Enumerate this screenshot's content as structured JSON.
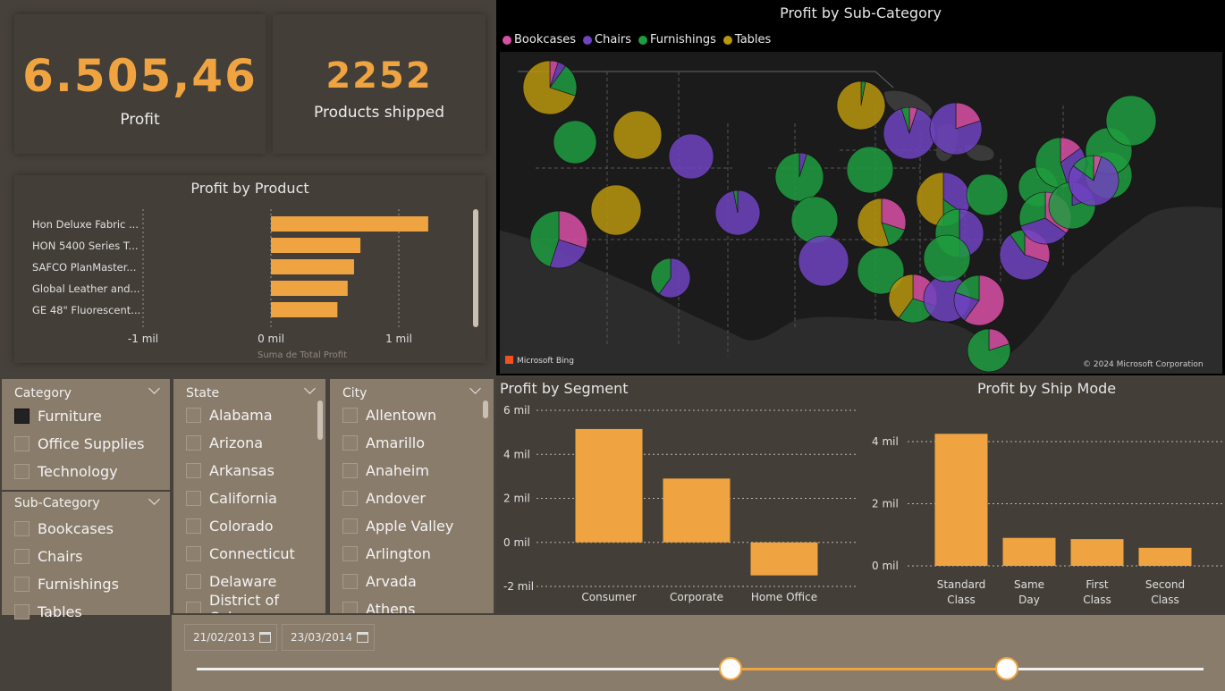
{
  "kpi": {
    "profit_value": "6.505,46",
    "profit_label": "Profit",
    "shipped_value": "2252",
    "shipped_label": "Products shipped"
  },
  "profit_by_product": {
    "title": "Profit by Product",
    "xlabel": "Suma de Total Profit",
    "ticks": [
      "-1 mil",
      "0 mil",
      "1 mil"
    ],
    "chart_data": {
      "type": "bar",
      "orientation": "horizontal",
      "title": "Profit by Product",
      "xlabel": "Suma de Total Profit",
      "categories": [
        "Hon Deluxe Fabric ...",
        "HON 5400 Series T...",
        "SAFCO PlanMaster...",
        "Global Leather and...",
        "GE 48\" Fluorescent..."
      ],
      "values": [
        1.23,
        0.7,
        0.65,
        0.6,
        0.52
      ],
      "unit": "mil",
      "xlim": [
        -1,
        1
      ],
      "color": "#efa441"
    }
  },
  "map": {
    "title": "Profit by Sub-Category",
    "legend": [
      {
        "name": "Bookcases",
        "color": "#d94fa5"
      },
      {
        "name": "Chairs",
        "color": "#6e43bf"
      },
      {
        "name": "Furnishings",
        "color": "#1f9c3f"
      },
      {
        "name": "Tables",
        "color": "#b8960e"
      }
    ],
    "bing_label": "Microsoft Bing",
    "copyright": "© 2024 Microsoft Corporation"
  },
  "slicers": {
    "category": {
      "header": "Category",
      "items": [
        {
          "label": "Furniture",
          "checked": true
        },
        {
          "label": "Office Supplies",
          "checked": false
        },
        {
          "label": "Technology",
          "checked": false
        }
      ]
    },
    "subcategory": {
      "header": "Sub-Category",
      "items": [
        {
          "label": "Bookcases"
        },
        {
          "label": "Chairs"
        },
        {
          "label": "Furnishings"
        },
        {
          "label": "Tables"
        }
      ]
    },
    "state": {
      "header": "State",
      "items": [
        "Alabama",
        "Arizona",
        "Arkansas",
        "California",
        "Colorado",
        "Connecticut",
        "Delaware",
        "District of Colu..."
      ]
    },
    "city": {
      "header": "City",
      "items": [
        "Allentown",
        "Amarillo",
        "Anaheim",
        "Andover",
        "Apple Valley",
        "Arlington",
        "Arvada",
        "Athens"
      ]
    }
  },
  "profit_by_segment": {
    "title": "Profit by Segment",
    "chart_data": {
      "type": "bar",
      "title": "Profit by Segment",
      "categories": [
        "Consumer",
        "Corporate",
        "Home Office"
      ],
      "values": [
        5.15,
        2.9,
        -1.5
      ],
      "unit": "mil",
      "ylim": [
        -2,
        6
      ],
      "yticks": [
        "6 mil",
        "4 mil",
        "2 mil",
        "0 mil",
        "-2 mil"
      ],
      "grid": true,
      "color": "#efa441"
    }
  },
  "profit_by_ship_mode": {
    "title": "Profit by Ship Mode",
    "chart_data": {
      "type": "bar",
      "title": "Profit by Ship Mode",
      "categories": [
        "Standard Class",
        "Same Day",
        "First Class",
        "Second Class"
      ],
      "values": [
        4.25,
        0.9,
        0.86,
        0.58
      ],
      "unit": "mil",
      "ylim": [
        0,
        4
      ],
      "yticks": [
        "4 mil",
        "2 mil",
        "0 mil"
      ],
      "grid": true,
      "color": "#efa441"
    }
  },
  "date_range": {
    "start": "21/02/2013",
    "end": "23/03/2014",
    "slider_start_fraction": 0.53,
    "slider_end_fraction": 0.805
  }
}
